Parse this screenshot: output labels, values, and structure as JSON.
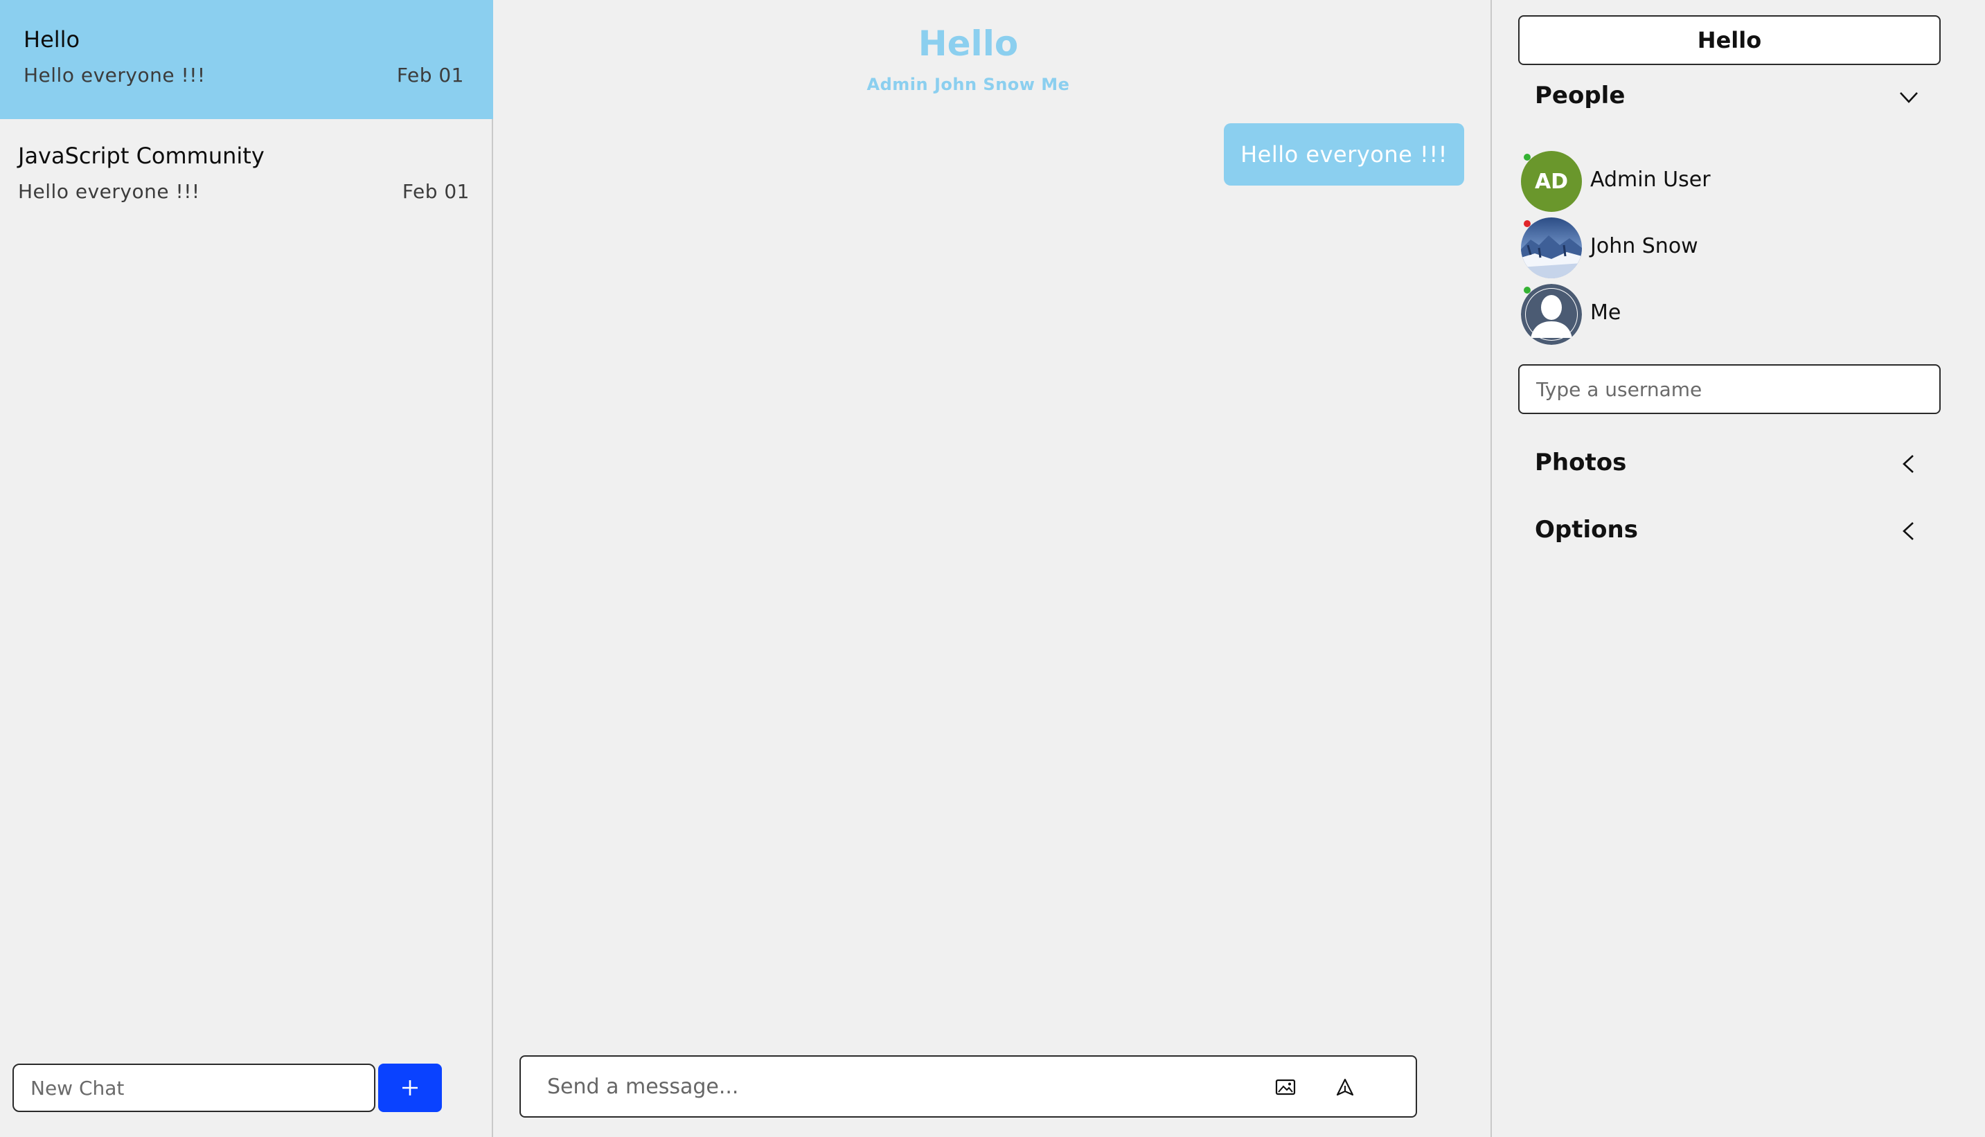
{
  "chats": [
    {
      "title": "Hello",
      "preview": "Hello everyone !!!",
      "date": "Feb 01",
      "active": true
    },
    {
      "title": "JavaScript Community",
      "preview": "Hello everyone !!!",
      "date": "Feb 01",
      "active": false
    }
  ],
  "new_chat": {
    "placeholder": "New Chat",
    "button_icon": "plus-icon"
  },
  "feed": {
    "title": "Hello",
    "subtitle": "Admin John Snow Me",
    "messages": [
      {
        "text": "Hello everyone !!!",
        "from_me": true
      }
    ],
    "composer": {
      "placeholder": "Send a message...",
      "attach_icon": "image-icon",
      "send_icon": "send-icon"
    }
  },
  "settings": {
    "title": "Hello",
    "people": {
      "label": "People",
      "expanded": true,
      "members": [
        {
          "name": "Admin User",
          "initials": "AD",
          "avatar": "initials",
          "online": true
        },
        {
          "name": "John Snow",
          "avatar": "photo-winter-landscape",
          "online": false
        },
        {
          "name": "Me",
          "avatar": "default-person",
          "online": true
        }
      ],
      "username_placeholder": "Type a username"
    },
    "photos": {
      "label": "Photos",
      "expanded": false
    },
    "options": {
      "label": "Options",
      "expanded": false
    }
  },
  "colors": {
    "accent": "#8bcfef",
    "button_blue": "#0a42ff",
    "avatar_green": "#6a972c",
    "online": "#34b233",
    "offline": "#e0262b",
    "background": "#f0f0f0"
  }
}
